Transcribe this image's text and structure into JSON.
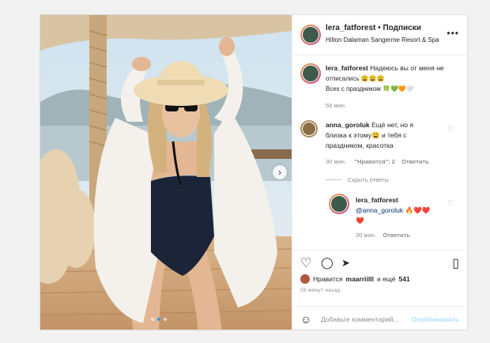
{
  "post": {
    "username": "lera_fatforest",
    "separator": "•",
    "follow_label": "Подписки",
    "location": "Hilton Dalaman Sangerme Resort & Spa",
    "more": "•••"
  },
  "photo": {
    "next": "›",
    "dots": 3,
    "active_dot": 1
  },
  "caption": {
    "username": "lera_fatforest",
    "text_line1": "Надеюсь вы от меня не",
    "text_line2": "отписались 😩😩😩",
    "text_line3": "Всех с праздником 🍀💚🧡🤍",
    "time": "59 мин."
  },
  "comments": [
    {
      "username": "anna_goroluk",
      "line1": "Ещё нет, но я",
      "line2": "близка к этому😩 и тебя с",
      "line3": "праздником, красотка",
      "time": "30 мин.",
      "likes": "\"Нравится\": 2",
      "reply": "Ответить",
      "hide": "Скрыть ответы"
    },
    {
      "username": "lera_fatforest",
      "line1": "@anna_goroluk 🔥❤️❤️",
      "line2": "❤️",
      "time": "30 мин.",
      "reply": "Ответить"
    }
  ],
  "actions": {
    "like": "♡",
    "comment": "◯",
    "share": "➤",
    "save": "▯"
  },
  "likes": {
    "prefix": "Нравится",
    "user": "maarriilll",
    "suffix": "и ещё",
    "count": "541"
  },
  "time_ago": "59 минут назад",
  "add_comment": {
    "placeholder": "Добавьте комментарий...",
    "post": "Опубликовать"
  },
  "colors": {
    "link_blue": "#3897f0",
    "post_disabled": "#b2dffc",
    "swimsuit": "#1c2438",
    "shirt": "#f4f1ec"
  }
}
